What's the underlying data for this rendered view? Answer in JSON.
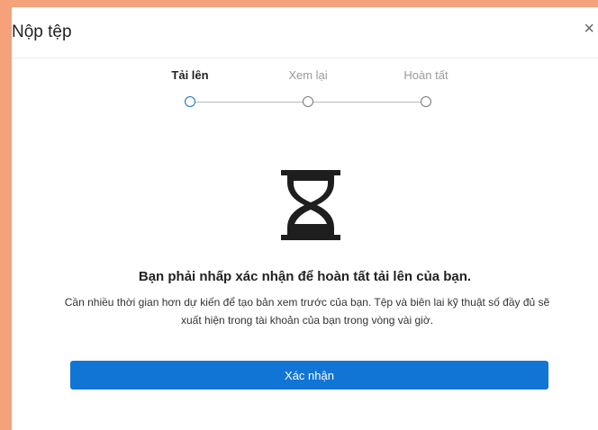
{
  "dialog": {
    "title": "Nộp tệp",
    "close_glyph": "×"
  },
  "stepper": {
    "steps": [
      {
        "label": "Tải lên",
        "active": true
      },
      {
        "label": "Xem lại",
        "active": false
      },
      {
        "label": "Hoàn tất",
        "active": false
      }
    ]
  },
  "status": {
    "icon": "hourglass-icon",
    "heading": "Bạn phải nhấp xác nhận để hoàn tất tải lên của bạn.",
    "description": "Cần nhiều thời gian hơn dự kiến để tạo bản xem trước của bạn. Tệp và biên lai kỹ thuật số đầy đủ sẽ xuất hiện trong tài khoản của bạn trong vòng vài giờ."
  },
  "actions": {
    "confirm_label": "Xác nhận"
  },
  "colors": {
    "accent": "#1175d6",
    "backdrop": "#f5a27a"
  }
}
